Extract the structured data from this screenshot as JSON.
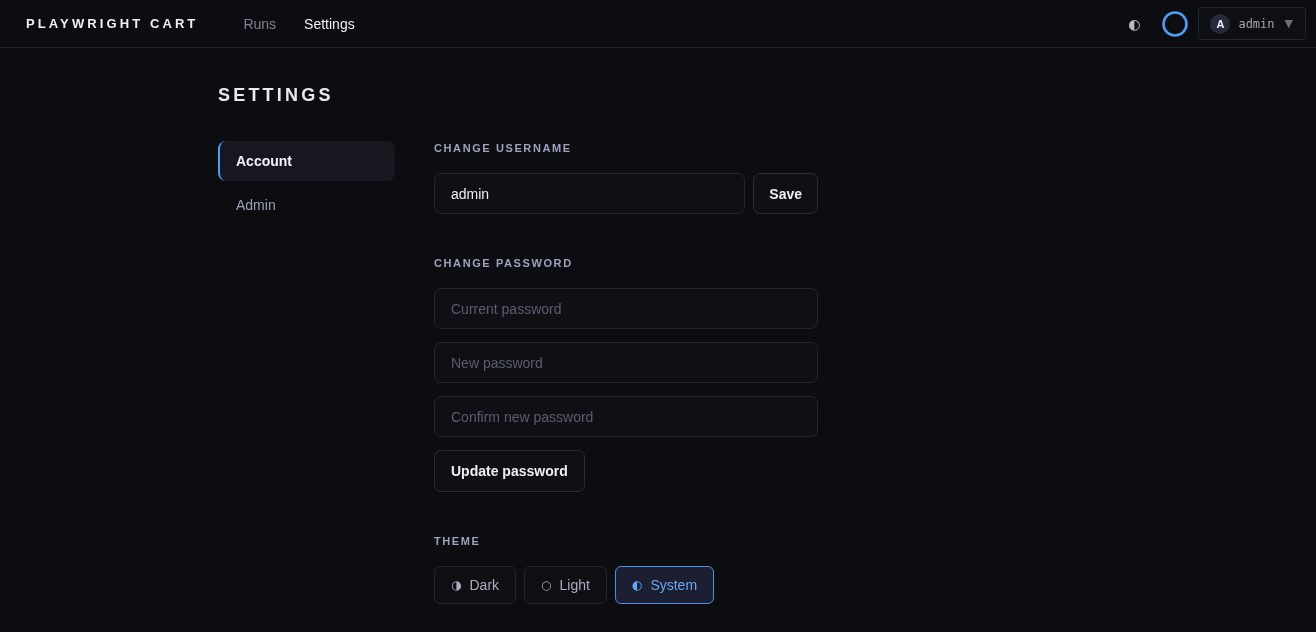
{
  "header": {
    "logo": "PLAYWRIGHT CART",
    "nav": [
      {
        "label": "Runs",
        "selected": false
      },
      {
        "label": "Settings",
        "selected": true
      }
    ],
    "theme_toggle": "◐",
    "user_menu": {
      "avatar": "A",
      "name": "admin",
      "caret": "▼"
    }
  },
  "page": {
    "title": "SETTINGS"
  },
  "sidebar": {
    "items": [
      {
        "label": "Account",
        "selected": true
      },
      {
        "label": "Admin",
        "selected": false
      }
    ]
  },
  "username": {
    "heading": "CHANGE USERNAME",
    "value": "admin",
    "button": "Save"
  },
  "password": {
    "heading": "CHANGE PASSWORD",
    "fields": [
      {
        "placeholder": "Current password"
      },
      {
        "placeholder": "New password"
      },
      {
        "placeholder": "Confirm new password"
      }
    ],
    "button": "Update password"
  },
  "theme": {
    "heading": "THEME",
    "options": [
      {
        "icon": "◑",
        "label": "Dark",
        "selected": false
      },
      {
        "icon": "○",
        "label": "Light",
        "selected": false
      },
      {
        "icon": "◐",
        "label": "System",
        "selected": true
      }
    ]
  }
}
